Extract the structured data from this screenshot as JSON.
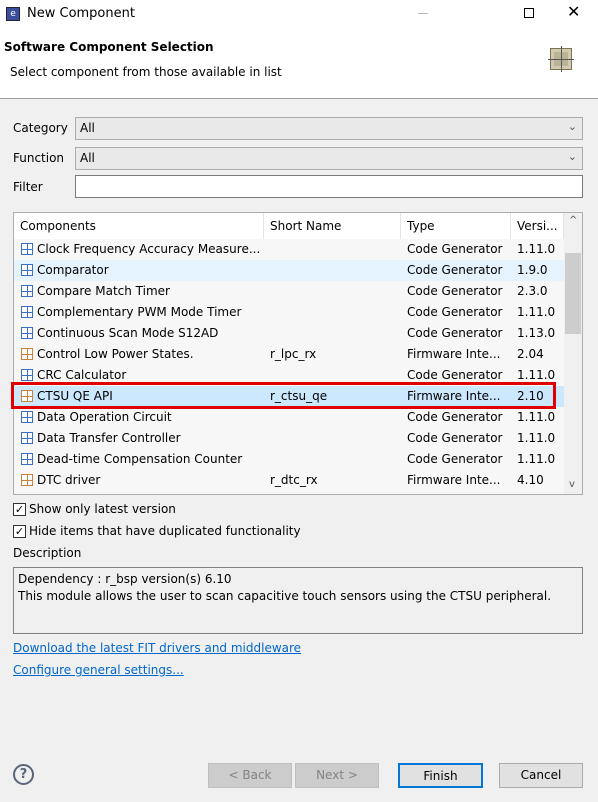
{
  "window": {
    "title": "New Component"
  },
  "header": {
    "title": "Software Component Selection",
    "subtitle": "Select component from those available in list"
  },
  "filters": {
    "category_label": "Category",
    "category_value": "All",
    "function_label": "Function",
    "function_value": "All",
    "filter_label": "Filter",
    "filter_value": ""
  },
  "table": {
    "columns": [
      "Components",
      "Short Name",
      "Type",
      "Versi..."
    ],
    "rows": [
      {
        "name": "Clock Frequency Accuracy Measure...",
        "short": "",
        "type": "Code Generator",
        "version": "1.11.0",
        "icon": "blue"
      },
      {
        "name": "Comparator",
        "short": "",
        "type": "Code Generator",
        "version": "1.9.0",
        "icon": "blue"
      },
      {
        "name": "Compare Match Timer",
        "short": "",
        "type": "Code Generator",
        "version": "2.3.0",
        "icon": "blue"
      },
      {
        "name": "Complementary PWM Mode Timer",
        "short": "",
        "type": "Code Generator",
        "version": "1.11.0",
        "icon": "blue"
      },
      {
        "name": "Continuous Scan Mode S12AD",
        "short": "",
        "type": "Code Generator",
        "version": "1.13.0",
        "icon": "blue"
      },
      {
        "name": "Control Low Power States.",
        "short": "r_lpc_rx",
        "type": "Firmware Inte...",
        "version": "2.04",
        "icon": "orange"
      },
      {
        "name": "CRC Calculator",
        "short": "",
        "type": "Code Generator",
        "version": "1.11.0",
        "icon": "blue"
      },
      {
        "name": "CTSU QE API",
        "short": "r_ctsu_qe",
        "type": "Firmware Inte...",
        "version": "2.10",
        "icon": "orange"
      },
      {
        "name": "Data Operation Circuit",
        "short": "",
        "type": "Code Generator",
        "version": "1.11.0",
        "icon": "blue"
      },
      {
        "name": "Data Transfer Controller",
        "short": "",
        "type": "Code Generator",
        "version": "1.11.0",
        "icon": "blue"
      },
      {
        "name": "Dead-time Compensation Counter",
        "short": "",
        "type": "Code Generator",
        "version": "1.11.0",
        "icon": "blue"
      },
      {
        "name": "DTC driver",
        "short": "r_dtc_rx",
        "type": "Firmware Inte...",
        "version": "4.10",
        "icon": "orange"
      }
    ],
    "selected_index": 7,
    "hover_index": 1
  },
  "options": {
    "latest_label": "Show only latest version",
    "latest_checked": true,
    "hide_label": "Hide items that have duplicated functionality",
    "hide_checked": true
  },
  "description": {
    "label": "Description",
    "line1": "Dependency : r_bsp version(s) 6.10",
    "line2": "This module allows the user to scan capacitive touch sensors using the CTSU peripheral."
  },
  "links": {
    "download": "Download the latest FIT drivers and middleware",
    "configure": "Configure general settings..."
  },
  "buttons": {
    "back": "< Back",
    "next": "Next >",
    "finish": "Finish",
    "cancel": "Cancel"
  },
  "colors": {
    "selected": "#cce8ff",
    "hover": "#e5f3ff",
    "highlight_border": "#e00000",
    "link": "#0066cc",
    "blue_icon": "#3a6fc4",
    "orange_icon": "#c8823a"
  }
}
